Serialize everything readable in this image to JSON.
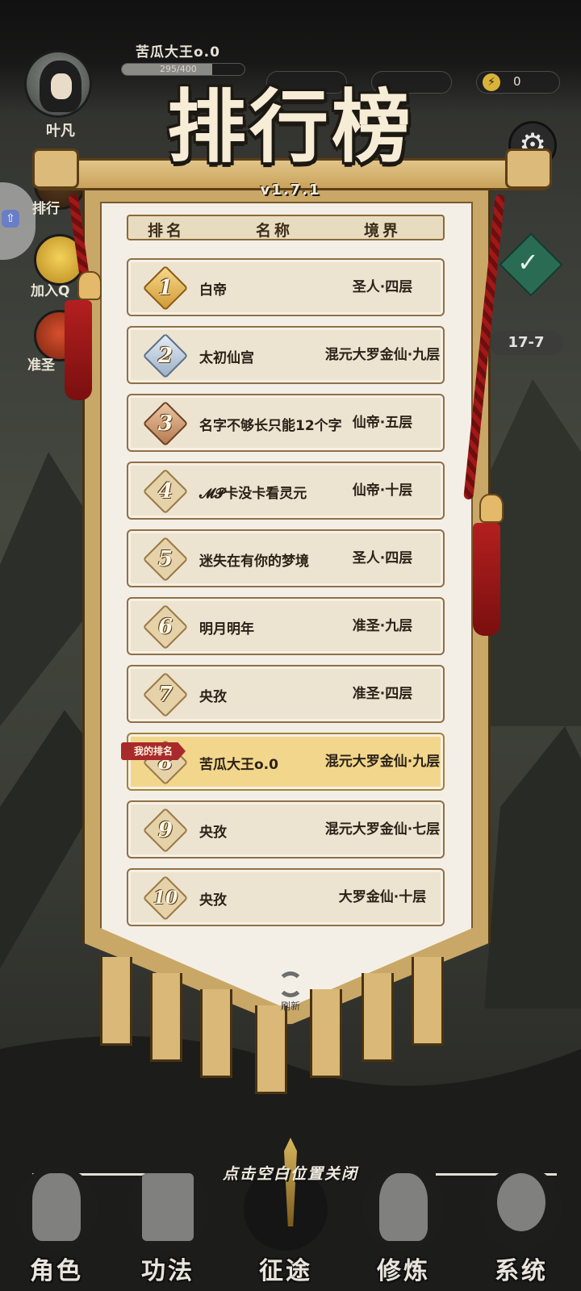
{
  "header": {
    "player_name": "苦瓜大王o.0",
    "avatar_label": "叶凡",
    "exp_text": "295/400",
    "exp_fraction": 0.74,
    "energy_value": "0"
  },
  "side_menu": {
    "rank_label": "排行",
    "join_label": "加入Q",
    "gift_label": "准圣"
  },
  "stage_indicator": "17-7",
  "leaderboard": {
    "title": "排行榜",
    "version": "v1.7.1",
    "columns": [
      "排名",
      "名称",
      "境界"
    ],
    "rows": [
      {
        "rank": "1",
        "name": "白帝",
        "realm": "圣人·四层",
        "badge": "gold"
      },
      {
        "rank": "2",
        "name": "太初仙宫",
        "realm": "混元大罗金仙·九层",
        "badge": "silver"
      },
      {
        "rank": "3",
        "name": "名字不够长只能12个字",
        "realm": "仙帝·五层",
        "badge": "bronze"
      },
      {
        "rank": "4",
        "name": "𝓜𝓟卡没卡看灵元",
        "realm": "仙帝·十层",
        "badge": "plain"
      },
      {
        "rank": "5",
        "name": "迷失在有你的梦境",
        "realm": "圣人·四层",
        "badge": "plain"
      },
      {
        "rank": "6",
        "name": "明月明年",
        "realm": "准圣·九层",
        "badge": "plain"
      },
      {
        "rank": "7",
        "name": "央孜",
        "realm": "准圣·四层",
        "badge": "plain"
      },
      {
        "rank": "8",
        "name": "苦瓜大王o.0",
        "realm": "混元大罗金仙·九层",
        "badge": "plain",
        "is_me": true
      },
      {
        "rank": "9",
        "name": "央孜",
        "realm": "混元大罗金仙·七层",
        "badge": "plain"
      },
      {
        "rank": "10",
        "name": "央孜",
        "realm": "大罗金仙·十层",
        "badge": "plain"
      }
    ],
    "my_rank_tag": "我的排名",
    "refresh_label": "刷新"
  },
  "close_hint": "点击空白位置关闭",
  "bottom_nav": [
    {
      "label": "角色",
      "icon": "character-icon"
    },
    {
      "label": "功法",
      "icon": "book-icon"
    },
    {
      "label": "征途",
      "icon": "sword-icon"
    },
    {
      "label": "修炼",
      "icon": "meditate-icon"
    },
    {
      "label": "系统",
      "icon": "system-icon"
    }
  ],
  "colors": {
    "banner_gold": "#c9a767",
    "row_bg": "#ede3d1",
    "my_row_bg": "#f1d68c",
    "tag_red": "#a82a2a"
  }
}
